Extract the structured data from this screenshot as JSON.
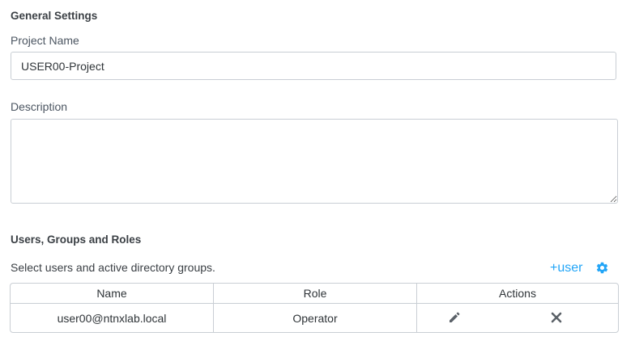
{
  "general": {
    "section_title": "General Settings",
    "project_name_label": "Project Name",
    "project_name_value": "USER00-Project",
    "description_label": "Description",
    "description_value": ""
  },
  "users": {
    "section_title": "Users, Groups and Roles",
    "helper_text": "Select users and active directory groups.",
    "add_user_label": "+user",
    "table": {
      "columns": [
        "Name",
        "Role",
        "Actions"
      ],
      "rows": [
        {
          "name": "user00@ntnxlab.local",
          "role": "Operator"
        }
      ]
    }
  },
  "colors": {
    "accent": "#22a5f7",
    "border": "#c9ced4",
    "text": "#3a3f44",
    "icon": "#5b6168"
  },
  "icons": {
    "settings": "gear-icon",
    "edit": "pencil-icon",
    "remove": "close-icon"
  }
}
